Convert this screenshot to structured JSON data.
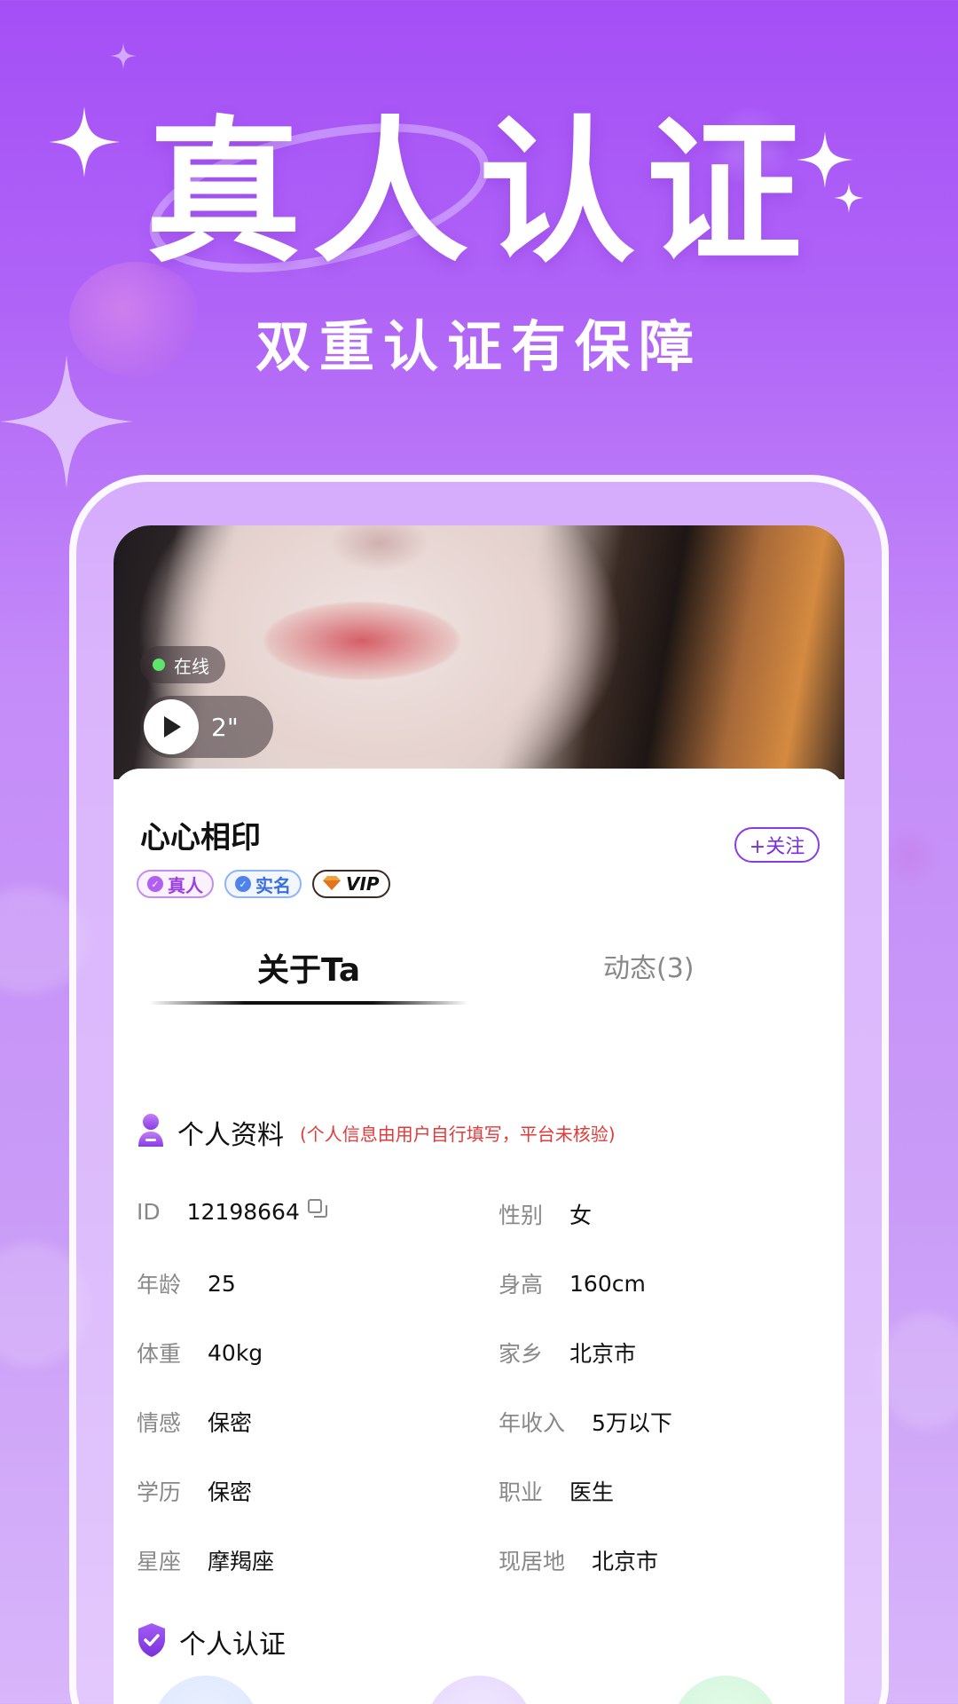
{
  "hero": {
    "title": "真人认证",
    "subtitle": "双重认证有保障"
  },
  "profile": {
    "online_label": "在线",
    "voice_duration": "2\"",
    "nickname": "心心相印",
    "follow_label": "+关注",
    "badges": {
      "real": "真人",
      "realname": "实名",
      "vip": "VIP"
    }
  },
  "tabs": {
    "about": "关于Ta",
    "moments": "动态(3)"
  },
  "personal_info": {
    "title": "个人资料",
    "note": "(个人信息由用户自行填写，平台未核验)",
    "fields": [
      {
        "key": "ID",
        "value": "12198664"
      },
      {
        "key": "性别",
        "value": "女"
      },
      {
        "key": "年龄",
        "value": "25"
      },
      {
        "key": "身高",
        "value": "160cm"
      },
      {
        "key": "体重",
        "value": "40kg"
      },
      {
        "key": "家乡",
        "value": "北京市"
      },
      {
        "key": "情感",
        "value": "保密"
      },
      {
        "key": "年收入",
        "value": "5万以下"
      },
      {
        "key": "学历",
        "value": "保密"
      },
      {
        "key": "职业",
        "value": "医生"
      },
      {
        "key": "星座",
        "value": "摩羯座"
      },
      {
        "key": "现居地",
        "value": "北京市"
      }
    ]
  },
  "certification": {
    "title": "个人认证"
  },
  "colors": {
    "accent": "#8a3be6",
    "note_red": "#e23a3a",
    "online_green": "#5ee36b"
  },
  "icons": [
    "sparkle-icon",
    "play-icon",
    "copy-icon",
    "person-icon",
    "shield-check-icon"
  ]
}
